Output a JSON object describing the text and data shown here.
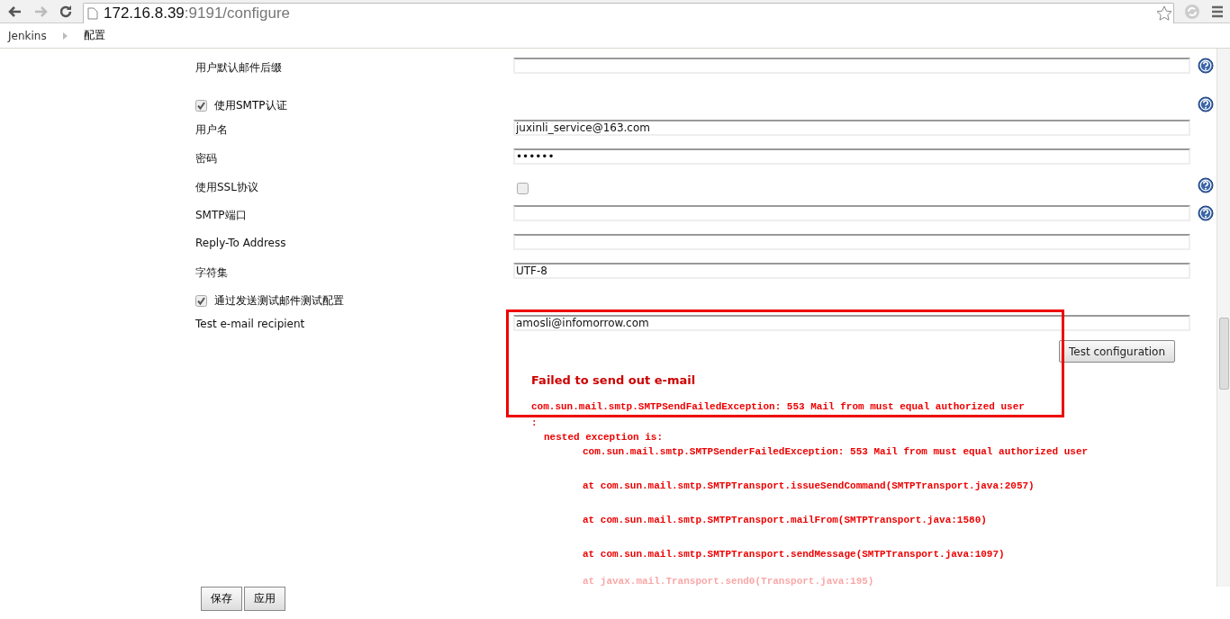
{
  "browser": {
    "url_host": "172.16.8.39",
    "url_rest": ":9191/configure"
  },
  "breadcrumbs": [
    "Jenkins",
    "配置"
  ],
  "rows": [
    {
      "kind": "field",
      "label": "用户默认邮件后缀",
      "value": "",
      "help": true
    },
    {
      "kind": "section",
      "label": "使用SMTP认证",
      "checked": true,
      "help": true
    },
    {
      "kind": "field",
      "label": "用户名",
      "value": "juxinli_service@163.com",
      "help": false
    },
    {
      "kind": "field",
      "label": "密码",
      "value": "••••••",
      "help": false
    },
    {
      "kind": "checkbox",
      "label": "使用SSL协议",
      "checked": false,
      "help": true
    },
    {
      "kind": "field",
      "label": "SMTP端口",
      "value": "",
      "help": true
    },
    {
      "kind": "field",
      "label": "Reply-To Address",
      "value": "",
      "help": false
    },
    {
      "kind": "field",
      "label": "字符集",
      "value": "UTF-8",
      "help": false
    },
    {
      "kind": "section",
      "label": "通过发送测试邮件测试配置",
      "checked": true,
      "help": false
    },
    {
      "kind": "field",
      "label": "Test e-mail recipient",
      "value": "amosli@infomorrow.com",
      "help": false
    }
  ],
  "test_button": "Test configuration",
  "error": {
    "title": "Failed to send out e-mail",
    "lines": [
      {
        "kind": "head",
        "text": "com.sun.mail.smtp.SMTPSendFailedException: 553 Mail from must equal authorized user"
      },
      {
        "kind": "head",
        "text": ":"
      },
      {
        "kind": "sub",
        "text": "nested exception is:"
      },
      {
        "kind": "deep",
        "text": "com.sun.mail.smtp.SMTPSenderFailedException: 553 Mail from must equal authorized user"
      },
      {
        "kind": "deep_gap",
        "text": "at com.sun.mail.smtp.SMTPTransport.issueSendCommand(SMTPTransport.java:2057)"
      },
      {
        "kind": "deep_gap",
        "text": "at com.sun.mail.smtp.SMTPTransport.mailFrom(SMTPTransport.java:1580)"
      },
      {
        "kind": "deep_gap",
        "text": "at com.sun.mail.smtp.SMTPTransport.sendMessage(SMTPTransport.java:1097)"
      },
      {
        "kind": "faded",
        "text": "at javax.mail.Transport.send0(Transport.java:195)"
      }
    ]
  },
  "footer_buttons": [
    "保存",
    "应用"
  ]
}
